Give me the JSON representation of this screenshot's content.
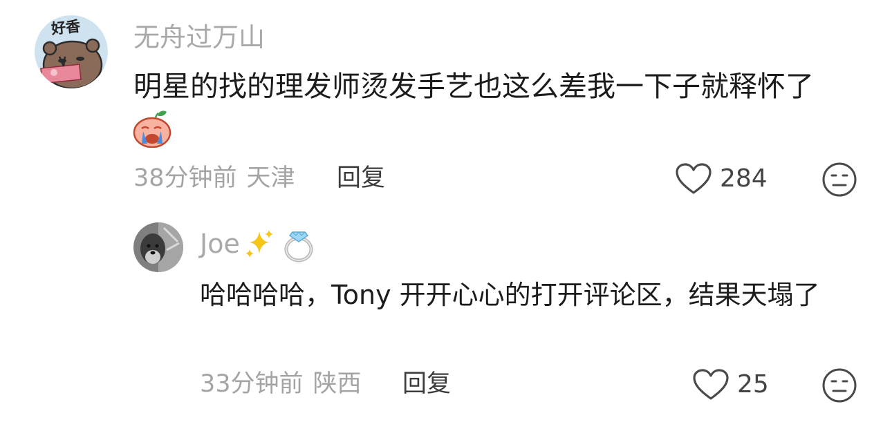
{
  "comments": [
    {
      "username": "无舟过万山",
      "avatar_icon": "bear-avatar-icon",
      "avatar_badge": "好香",
      "text": "明星的找的理发师烫发手艺也这么差我一下子就释怀了",
      "emoji": "crying-peach-emoji",
      "time": "38分钟前",
      "location": "天津",
      "reply_label": "回复",
      "like_count": "284",
      "like_icon": "heart-outline-icon",
      "react_icon": "neutral-face-icon"
    },
    {
      "username": "Joe",
      "username_emojis": [
        "sparkles-emoji",
        "ring-emoji"
      ],
      "avatar_icon": "dog-photo-avatar",
      "text": "哈哈哈哈，Tony 开开心心的打开评论区，结果天塌了",
      "time": "33分钟前",
      "location": "陕西",
      "reply_label": "回复",
      "like_count": "25",
      "like_icon": "heart-outline-icon",
      "react_icon": "neutral-face-icon"
    }
  ],
  "colors": {
    "username": "#a9a9a9",
    "meta": "#a4a4a4",
    "text": "#1c1c1c",
    "reply": "#3c3c3c",
    "icon_stroke": "#4a4a4a"
  }
}
